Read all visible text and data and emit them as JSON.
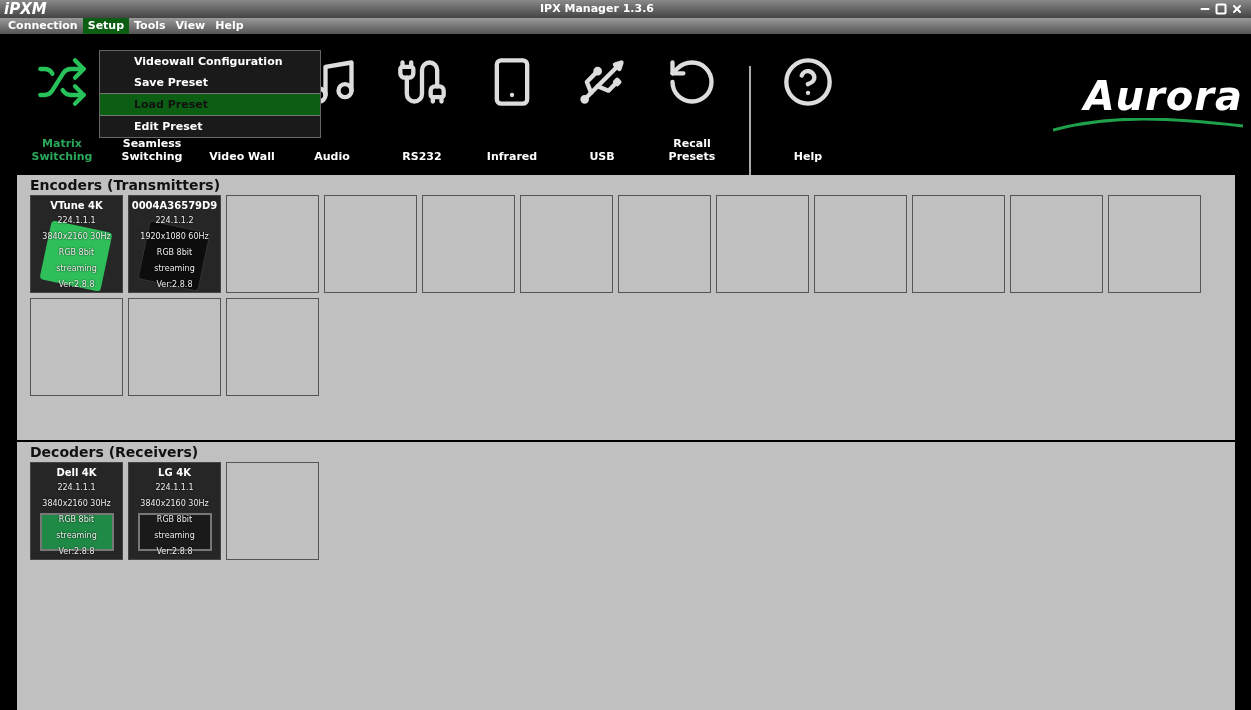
{
  "window": {
    "logo": "iPXM",
    "title": "IPX Manager 1.3.6"
  },
  "menu": [
    {
      "label": "Connection",
      "selected": false
    },
    {
      "label": "Setup",
      "selected": true
    },
    {
      "label": "Tools",
      "selected": false
    },
    {
      "label": "View",
      "selected": false
    },
    {
      "label": "Help",
      "selected": false
    }
  ],
  "dropdown": [
    {
      "label": "Videowall Configuration",
      "selected": false
    },
    {
      "label": "Save Preset",
      "selected": false
    },
    {
      "label": "Load Preset",
      "selected": true
    },
    {
      "label": "Edit Preset",
      "selected": false
    }
  ],
  "toolbar": [
    {
      "label": "Matrix Switching",
      "selected": true
    },
    {
      "label": "Seamless Switching",
      "selected": false
    },
    {
      "label": "Video Wall",
      "selected": false
    },
    {
      "label": "Audio",
      "selected": false
    },
    {
      "label": "RS232",
      "selected": false
    },
    {
      "label": "Infrared",
      "selected": false
    },
    {
      "label": "USB",
      "selected": false
    },
    {
      "label": "Recall Presets",
      "selected": false
    },
    {
      "label": "Help",
      "selected": false
    }
  ],
  "brand": "Aurora",
  "encoders": {
    "title": "Encoders (Transmitters)",
    "slots": [
      {
        "kind": "device",
        "highlighted": true,
        "name": "VTune 4K",
        "ip": "224.1.1.1",
        "resolution": "3840x2160 30Hz",
        "color_format": "RGB 8bit",
        "status": "streaming",
        "version": "Ver:2.8.8"
      },
      {
        "kind": "device",
        "highlighted": false,
        "name": "0004A36579D9",
        "ip": "224.1.1.2",
        "resolution": "1920x1080 60Hz",
        "color_format": "RGB 8bit",
        "status": "streaming",
        "version": "Ver:2.8.8"
      },
      {
        "kind": "empty"
      },
      {
        "kind": "empty"
      },
      {
        "kind": "empty"
      },
      {
        "kind": "empty"
      },
      {
        "kind": "empty"
      },
      {
        "kind": "empty"
      },
      {
        "kind": "empty"
      },
      {
        "kind": "empty"
      },
      {
        "kind": "empty"
      },
      {
        "kind": "empty"
      },
      {
        "kind": "empty"
      },
      {
        "kind": "empty"
      },
      {
        "kind": "empty"
      }
    ]
  },
  "decoders": {
    "title": "Decoders (Receivers)",
    "slots": [
      {
        "kind": "device",
        "highlighted": true,
        "name": "Dell 4K",
        "ip": "224.1.1.1",
        "resolution": "3840x2160 30Hz",
        "color_format": "RGB 8bit",
        "status": "streaming",
        "version": "Ver:2.8.8"
      },
      {
        "kind": "device",
        "highlighted": false,
        "name": "LG 4K",
        "ip": "224.1.1.1",
        "resolution": "3840x2160 30Hz",
        "color_format": "RGB 8bit",
        "status": "streaming",
        "version": "Ver:2.8.8"
      },
      {
        "kind": "empty"
      }
    ]
  }
}
